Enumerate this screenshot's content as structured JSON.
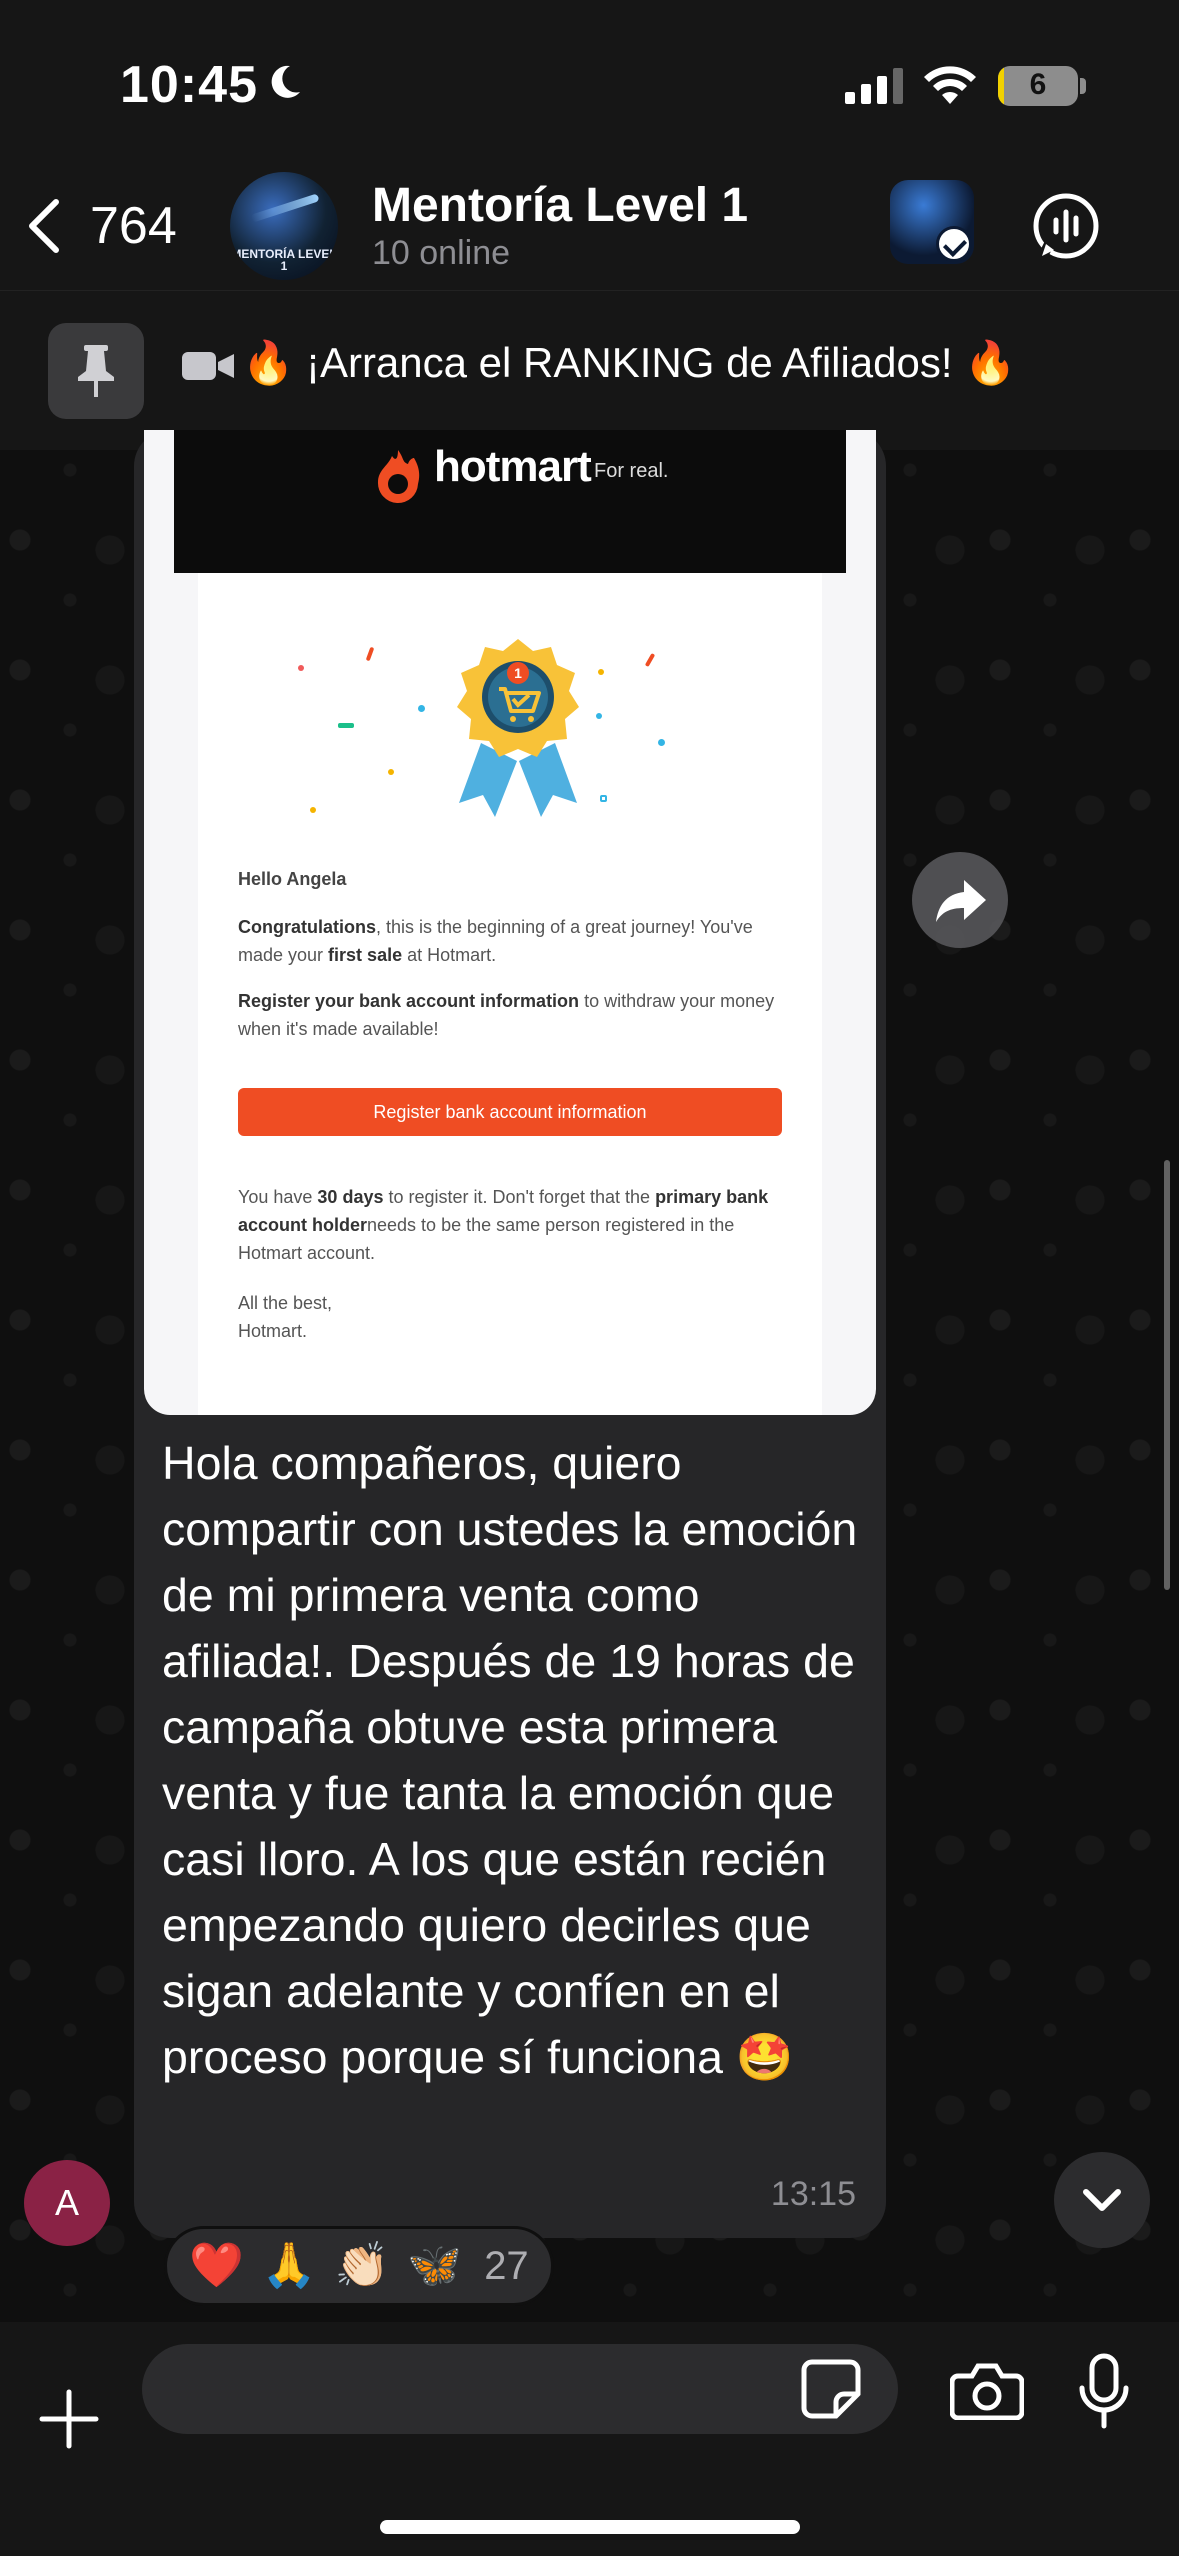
{
  "status_bar": {
    "time": "10:45",
    "battery": "6"
  },
  "header": {
    "back_count": "764",
    "title": "Mentoría Level 1",
    "subtitle": "10 online",
    "avatar_text": "MENTORÍA LEVEL 1"
  },
  "pinned": {
    "text": "🔥 ¡Arranca el RANKING de Afiliados! 🔥"
  },
  "email": {
    "brand": "hotmart",
    "tagline": "For real.",
    "greeting": "Hello Angela",
    "p1_strong1": "Congratulations",
    "p1_text1": ", this is the beginning of a great journey! You've made your ",
    "p1_strong2": "first sale",
    "p1_text2": " at Hotmart.",
    "p2_strong": "Register your bank account information",
    "p2_text": " to withdraw your money when it's made available!",
    "button": "Register bank account information",
    "p3_text1": "You have ",
    "p3_strong1": "30 days",
    "p3_text2": " to register it. Don't forget that the ",
    "p3_strong2": "primary bank account holder",
    "p3_text3": "needs to be the same person registered in the Hotmart account.",
    "signoff_1": "All the best,",
    "signoff_2": "Hotmart."
  },
  "message": {
    "text": "Hola compañeros, quiero compartir con ustedes la emoción de mi primera venta como afiliada!. Después de 19 horas de campaña obtuve esta primera venta y fue tanta la emoción que casi lloro. A los que están recién empezando quiero decirles que sigan adelante y confíen en el proceso porque sí funciona 🤩",
    "time": "13:15"
  },
  "reactions": {
    "items": [
      "❤️",
      "🙏",
      "👏🏻",
      "🦋"
    ],
    "count": "27"
  },
  "sender": {
    "initial": "A"
  },
  "input": {
    "placeholder": ""
  },
  "colors": {
    "accent_orange": "#ef4d23",
    "bubble": "#262628",
    "sender_avatar": "#8a2245"
  }
}
